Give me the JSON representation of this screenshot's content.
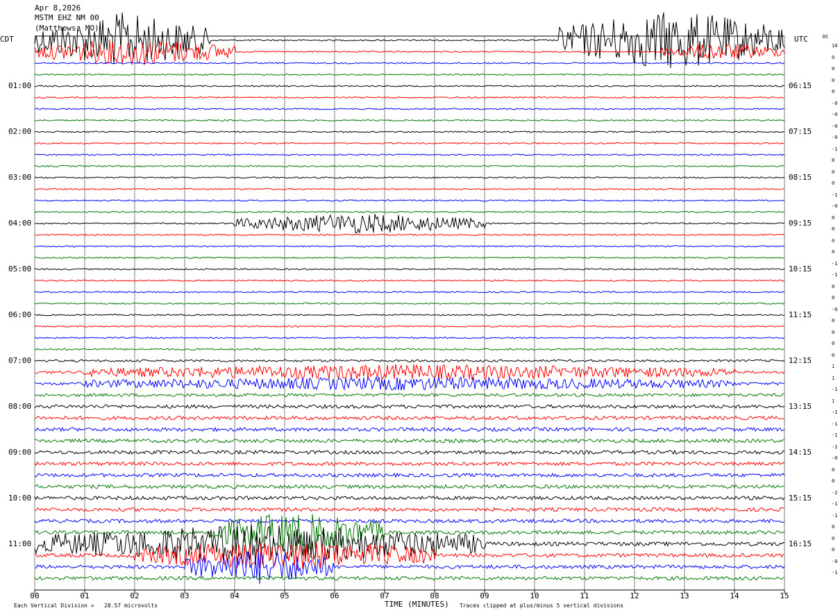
{
  "header": {
    "date": "Apr 8,2026",
    "station": "MSTM EHZ NM 00",
    "location": "(Matthews, MO)"
  },
  "left_tz": "CDT",
  "right_tz": "UTC",
  "dc_label": "DC",
  "footer": {
    "scale_label": "Each Vertical Division =   28.57 microvolts",
    "clip_note": "Traces clipped at plus/minus 5 vertical divisions"
  },
  "colors": {
    "trace_cycle": [
      "#000000",
      "#ff0000",
      "#0000ff",
      "#007700"
    ],
    "grid": "#808080"
  },
  "chart_data": {
    "type": "line",
    "xlabel": "TIME (MINUTES)",
    "xlim": [
      0,
      15
    ],
    "x_ticks": [
      "00",
      "01",
      "02",
      "03",
      "04",
      "05",
      "06",
      "07",
      "08",
      "09",
      "10",
      "11",
      "12",
      "13",
      "14",
      "15"
    ],
    "trace_count": 48,
    "minutes_per_trace": 15,
    "left_hour_labels": [
      "01:00",
      "02:00",
      "03:00",
      "04:00",
      "05:00",
      "06:00",
      "07:00",
      "08:00",
      "09:00",
      "10:00",
      "11:00"
    ],
    "right_hour_labels": [
      "06:15",
      "07:15",
      "08:15",
      "09:15",
      "10:15",
      "11:15",
      "12:15",
      "13:15",
      "14:15",
      "15:15",
      "16:15"
    ],
    "dc_offsets": [
      "10",
      "0",
      "0",
      "0",
      "0",
      "-0",
      "-0",
      "-0",
      "-0",
      "-1",
      "0",
      "0",
      "0",
      "-1",
      "-0",
      "0",
      "0",
      "0",
      "0",
      "-1",
      "-1",
      "0",
      "0",
      "-0",
      "0",
      "0",
      "0",
      "0",
      "1",
      "1",
      "-1",
      "1",
      "-1",
      "-1",
      "-1",
      "-1",
      "-0",
      "0",
      "0",
      "-2",
      "-1",
      "-1",
      "0",
      "0",
      "0",
      "-0",
      "-1"
    ],
    "activity": [
      1.0,
      1.0,
      1.0,
      1.0,
      1.0,
      1.0,
      1.0,
      1.0,
      1.0,
      1.0,
      1.0,
      1.0,
      1.0,
      1.0,
      1.0,
      1.0,
      1.0,
      1.0,
      1.0,
      1.0,
      1.0,
      1.0,
      1.0,
      1.0,
      1.0,
      1.0,
      1.0,
      1.3,
      1.6,
      1.8,
      2.0,
      2.2,
      2.5,
      2.6,
      2.6,
      2.6,
      2.6,
      2.6,
      2.6,
      2.6,
      2.6,
      2.6,
      2.6,
      2.6,
      2.8,
      2.6,
      2.6,
      2.6
    ]
  }
}
